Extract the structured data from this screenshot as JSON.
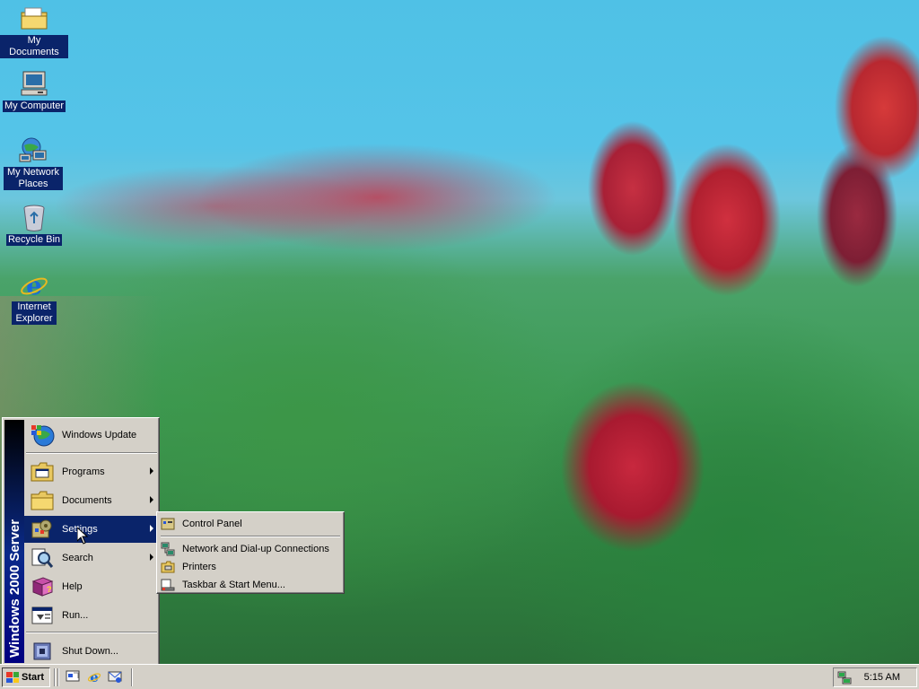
{
  "desktop": {
    "icons": [
      {
        "label": "My Documents",
        "icon": "folder-documents-icon"
      },
      {
        "label": "My Computer",
        "icon": "computer-icon"
      },
      {
        "label": "My Network Places",
        "icon": "network-places-icon"
      },
      {
        "label": "Recycle Bin",
        "icon": "recycle-bin-icon"
      },
      {
        "label": "Internet Explorer",
        "icon": "internet-explorer-icon"
      }
    ]
  },
  "start_menu": {
    "banner_text": "Windows 2000 Server",
    "items": [
      {
        "label": "Windows Update",
        "has_submenu": false
      },
      {
        "label": "Programs",
        "has_submenu": true
      },
      {
        "label": "Documents",
        "has_submenu": true
      },
      {
        "label": "Settings",
        "has_submenu": true,
        "selected": true
      },
      {
        "label": "Search",
        "has_submenu": true
      },
      {
        "label": "Help",
        "has_submenu": false
      },
      {
        "label": "Run...",
        "has_submenu": false
      },
      {
        "label": "Shut Down...",
        "has_submenu": false
      }
    ]
  },
  "settings_submenu": {
    "items": [
      {
        "label": "Control Panel"
      },
      {
        "label": "Network and Dial-up Connections"
      },
      {
        "label": "Printers"
      },
      {
        "label": "Taskbar & Start Menu..."
      }
    ]
  },
  "taskbar": {
    "start_label": "Start",
    "quick_launch": [
      "show-desktop-icon",
      "internet-explorer-icon",
      "outlook-express-icon"
    ],
    "clock": "5:15 AM"
  },
  "colors": {
    "selection": "#0a246a",
    "face": "#d4d0c8",
    "banner": "#000080"
  }
}
